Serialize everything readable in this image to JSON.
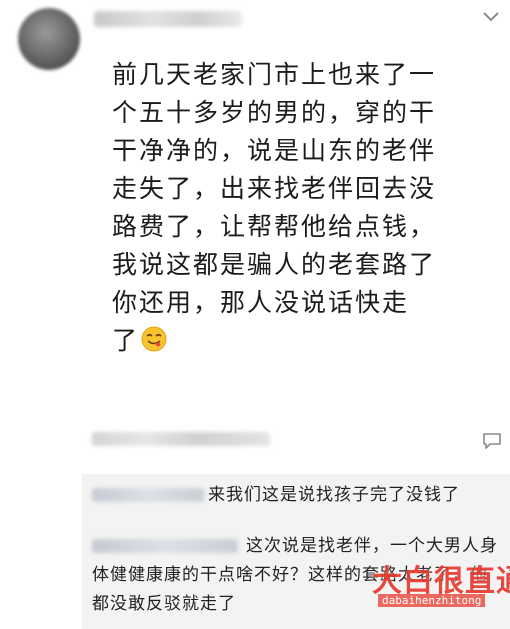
{
  "post": {
    "avatar_icon": "user-avatar-icon",
    "menu_icon": "chevron-down-icon",
    "content": "前几天老家门市上也来了一\n个五十多岁的男的，穿的干\n干净净的，说是山东的老伴\n走失了，出来找老伴回去没\n路费了，让帮帮他给点钱，\n我说这都是骗人的老套路了\n你还用，那人没说话快走\n了",
    "emoji_icon": "tongue-out-smiley-icon",
    "comment_icon": "comment-bubble-icon"
  },
  "replies": [
    {
      "text": "来我们这是说找孩子完了没钱了"
    },
    {
      "text": "这次说是找老伴，一个大男人身体健健康康的干点啥不好？这样的套路太老了，他都没敢反驳就走了"
    }
  ],
  "watermark": {
    "title": "大白很直通",
    "subtitle": "dabaihenzhitong"
  },
  "colors": {
    "background": "#ffffff",
    "reply_background": "#f3f3f3",
    "watermark": "#e83a2e"
  }
}
